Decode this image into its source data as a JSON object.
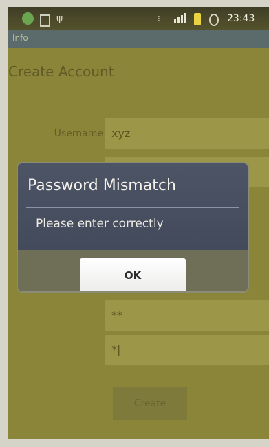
{
  "status_bar": {
    "time": "23:43",
    "icons": [
      "whatsapp-icon",
      "mail-icon",
      "usb-icon",
      "wifi-icon",
      "signal-icon",
      "battery-icon",
      "alarm-icon"
    ]
  },
  "title_bar": {
    "title": "Info"
  },
  "form": {
    "heading": "Create Account",
    "username_label": "Username",
    "username_value": "xyz",
    "password_value": "**",
    "confirm_value": "*|",
    "create_label": "Create"
  },
  "dialog": {
    "title": "Password Mismatch",
    "message": "Please enter correctly",
    "ok_label": "OK"
  },
  "colors": {
    "dialog_header": "#434a5c",
    "overlay_tint": "#8a8538",
    "ok_button": "#f5f5f4"
  }
}
